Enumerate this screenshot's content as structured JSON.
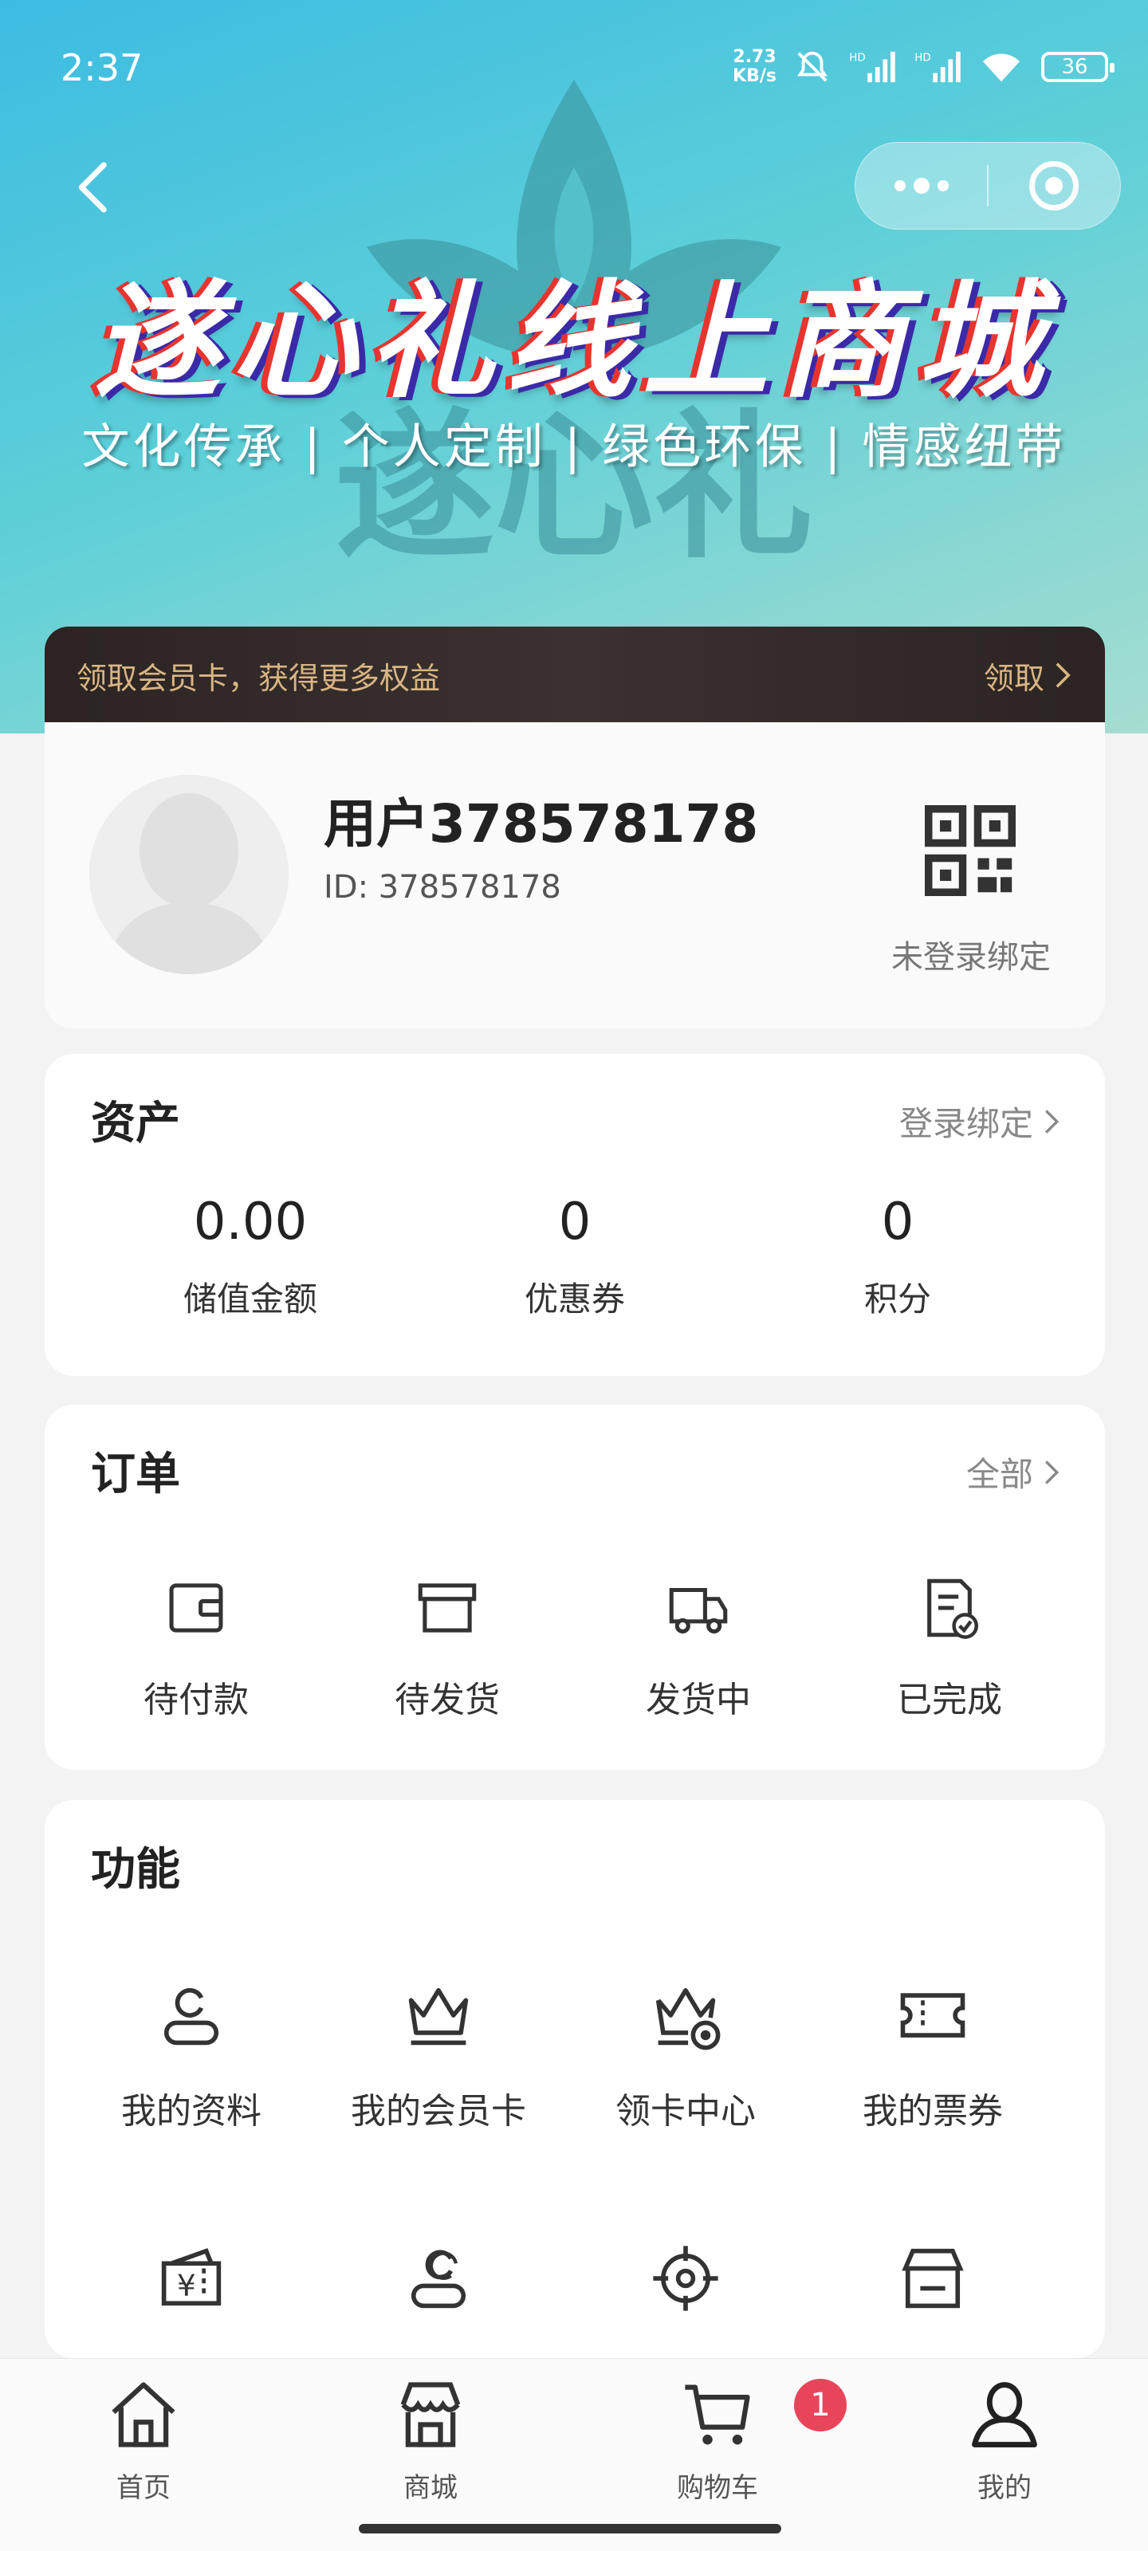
{
  "status_bar": {
    "time": "2:37",
    "net_speed_value": "2.73",
    "net_speed_unit": "KB/s",
    "battery": "36"
  },
  "banner": {
    "title": "遂心礼线上商城",
    "subtitle": "文化传承 | 个人定制 | 绿色环保 | 情感纽带",
    "watermark": "遂心礼"
  },
  "member_strip": {
    "text": "领取会员卡，获得更多权益",
    "claim_label": "领取"
  },
  "profile": {
    "name": "用户378578178",
    "id_text": "ID: 378578178",
    "qr_label": "未登录绑定"
  },
  "assets": {
    "title": "资产",
    "link": "登录绑定",
    "items": [
      {
        "value": "0.00",
        "label": "储值金额"
      },
      {
        "value": "0",
        "label": "优惠券"
      },
      {
        "value": "0",
        "label": "积分"
      }
    ]
  },
  "orders": {
    "title": "订单",
    "link": "全部",
    "items": [
      {
        "label": "待付款",
        "icon": "wallet-icon"
      },
      {
        "label": "待发货",
        "icon": "box-icon"
      },
      {
        "label": "发货中",
        "icon": "truck-icon"
      },
      {
        "label": "已完成",
        "icon": "document-check-icon"
      }
    ]
  },
  "functions": {
    "title": "功能",
    "items": [
      {
        "label": "我的资料",
        "icon": "user-profile-icon"
      },
      {
        "label": "我的会员卡",
        "icon": "crown-icon"
      },
      {
        "label": "领卡中心",
        "icon": "crown-badge-icon"
      },
      {
        "label": "我的票券",
        "icon": "ticket-icon"
      },
      {
        "label": "",
        "icon": "yen-coupon-icon"
      },
      {
        "label": "",
        "icon": "users-icon"
      },
      {
        "label": "",
        "icon": "target-icon"
      },
      {
        "label": "",
        "icon": "store-icon"
      }
    ]
  },
  "tabbar": {
    "items": [
      {
        "label": "首页",
        "icon": "home-icon"
      },
      {
        "label": "商城",
        "icon": "shop-icon"
      },
      {
        "label": "购物车",
        "icon": "cart-icon"
      },
      {
        "label": "我的",
        "icon": "person-icon"
      }
    ],
    "cart_badge": "1"
  },
  "colors": {
    "banner_start": "#3dbbe2",
    "banner_end": "#a6ddd0",
    "member_gold": "#d9b583",
    "badge_red": "#e8455a"
  }
}
